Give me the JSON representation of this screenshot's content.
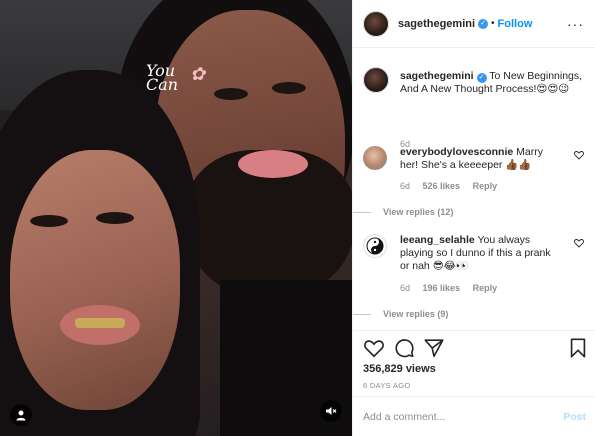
{
  "header": {
    "username": "sagethegemini",
    "dot": "•",
    "follow_label": "Follow",
    "more_label": "···"
  },
  "media": {
    "sticker_text": "You Can",
    "sticker_flower": "✿"
  },
  "caption": {
    "username": "sagethegemini",
    "text": "To New Beginnings, And A New Thought Process!😍😍😉",
    "time": "6d"
  },
  "comments": [
    {
      "username": "everybodylovesconnie",
      "text": "Marry her! She's a keeeeper 👍🏾👍🏾",
      "time": "6d",
      "likes": "526 likes",
      "reply_label": "Reply",
      "view_replies": "View replies (12)"
    },
    {
      "username": "leeang_selahle",
      "text": "You always playing so I dunno if this a prank or nah 😎😂👀",
      "time": "6d",
      "likes": "196 likes",
      "reply_label": "Reply",
      "view_replies": "View replies (9)"
    }
  ],
  "stats": {
    "views": "356,829 views",
    "ago": "6 DAYS AGO"
  },
  "add_comment": {
    "placeholder": "Add a comment...",
    "post_label": "Post"
  },
  "colors": {
    "accent": "#0095f6",
    "post_disabled": "#b2dffc",
    "muted": "#8e8e8e"
  }
}
